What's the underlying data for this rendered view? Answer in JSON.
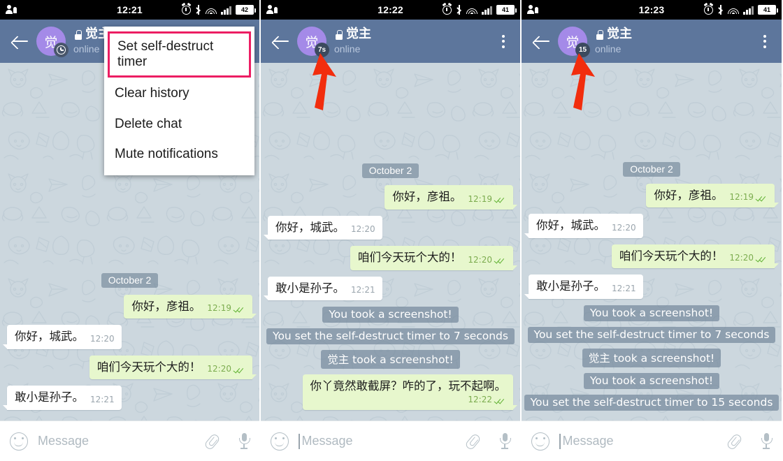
{
  "app": {
    "chat_title": "觉主",
    "chat_status": "online",
    "avatar_initial": "觉",
    "message_placeholder": "Message",
    "colors": {
      "header": "#5d769c",
      "chat_background": "#ccd7de",
      "avatar": "#a48ae8",
      "outgoing_bubble": "#e7f7cd",
      "incoming_bubble": "#ffffff",
      "service_bubble": "#6e8396",
      "highlight_border": "#ec1e63",
      "arrow": "#f22d0d"
    }
  },
  "panels": [
    {
      "id": "panel-1",
      "status_bar": {
        "time": "12:21",
        "battery": "42"
      },
      "header": {
        "timer_badge": "",
        "timer_badge_icon": "clock-icon"
      },
      "menu": {
        "visible": true,
        "items": [
          {
            "label": "Set self-destruct timer",
            "highlighted": true
          },
          {
            "label": "Clear history",
            "highlighted": false
          },
          {
            "label": "Delete chat",
            "highlighted": false
          },
          {
            "label": "Mute notifications",
            "highlighted": false
          }
        ]
      },
      "arrow": false,
      "composer_caret": false,
      "day_divider": "October 2",
      "messages": [
        {
          "kind": "day",
          "text": "October 2"
        },
        {
          "kind": "out",
          "text": "你好，彦祖。",
          "time": "12:19",
          "ticks": true
        },
        {
          "kind": "in",
          "text": "你好，城武。",
          "time": "12:20",
          "ticks": false
        },
        {
          "kind": "out",
          "text": "咱们今天玩个大的！",
          "time": "12:20",
          "ticks": true
        },
        {
          "kind": "in",
          "text": "敢小是孙子。",
          "time": "12:21",
          "ticks": false
        }
      ]
    },
    {
      "id": "panel-2",
      "status_bar": {
        "time": "12:22",
        "battery": "41"
      },
      "header": {
        "timer_badge": "7s",
        "timer_badge_icon": ""
      },
      "menu": {
        "visible": false,
        "items": []
      },
      "arrow": true,
      "composer_caret": true,
      "day_divider": "October 2",
      "messages": [
        {
          "kind": "day",
          "text": "October 2"
        },
        {
          "kind": "out",
          "text": "你好，彦祖。",
          "time": "12:19",
          "ticks": true
        },
        {
          "kind": "in",
          "text": "你好，城武。",
          "time": "12:20",
          "ticks": false
        },
        {
          "kind": "out",
          "text": "咱们今天玩个大的！",
          "time": "12:20",
          "ticks": true
        },
        {
          "kind": "in",
          "text": "敢小是孙子。",
          "time": "12:21",
          "ticks": false
        },
        {
          "kind": "service",
          "text": "You took a screenshot!"
        },
        {
          "kind": "service",
          "text": "You set the self-destruct timer to 7 seconds"
        },
        {
          "kind": "service",
          "text": "觉主 took a screenshot!"
        },
        {
          "kind": "out-wrapped",
          "text": "你丫竟然敢截屏？咋的了，玩不起啊。",
          "time": "12:22",
          "ticks": true
        }
      ]
    },
    {
      "id": "panel-3",
      "status_bar": {
        "time": "12:23",
        "battery": "41"
      },
      "header": {
        "timer_badge": "15",
        "timer_badge_icon": ""
      },
      "menu": {
        "visible": false,
        "items": []
      },
      "arrow": true,
      "composer_caret": true,
      "day_divider": "October 2",
      "messages": [
        {
          "kind": "day",
          "text": "October 2"
        },
        {
          "kind": "out",
          "text": "你好，彦祖。",
          "time": "12:19",
          "ticks": true
        },
        {
          "kind": "in",
          "text": "你好，城武。",
          "time": "12:20",
          "ticks": false
        },
        {
          "kind": "out",
          "text": "咱们今天玩个大的！",
          "time": "12:20",
          "ticks": true
        },
        {
          "kind": "in",
          "text": "敢小是孙子。",
          "time": "12:21",
          "ticks": false
        },
        {
          "kind": "service",
          "text": "You took a screenshot!"
        },
        {
          "kind": "service",
          "text": "You set the self-destruct timer to 7 seconds"
        },
        {
          "kind": "service",
          "text": "觉主 took a screenshot!"
        },
        {
          "kind": "service",
          "text": "You took a screenshot!"
        },
        {
          "kind": "service",
          "text": "You set the self-destruct timer to 15 seconds"
        }
      ]
    }
  ]
}
